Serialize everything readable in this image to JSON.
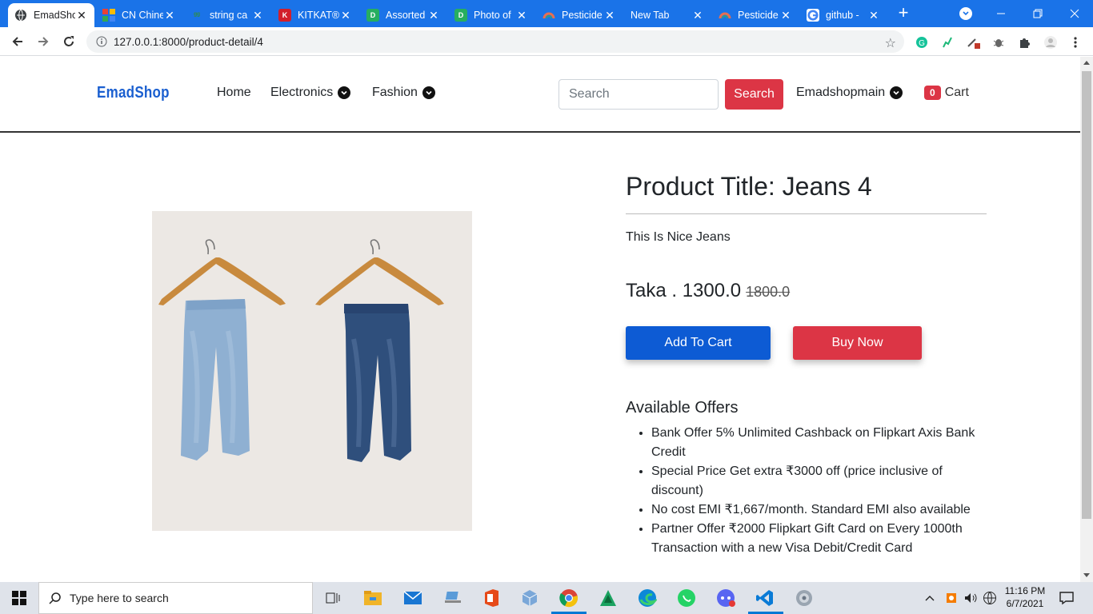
{
  "browser": {
    "tabs": [
      {
        "title": "EmadShop",
        "active": true,
        "favicon": "globe-icon",
        "color": "#3c4043"
      },
      {
        "title": "CN Chinese",
        "favicon": "grid-icon",
        "color": "#e94235"
      },
      {
        "title": "string ca",
        "favicon": "gfg-icon",
        "color": "#2f8d46"
      },
      {
        "title": "KITKAT®",
        "favicon": "kitkat-icon",
        "color": "#d21f2b"
      },
      {
        "title": "Assorted",
        "favicon": "d-icon",
        "color": "#27ae60"
      },
      {
        "title": "Photo of",
        "favicon": "d-icon",
        "color": "#27ae60"
      },
      {
        "title": "Pesticide",
        "favicon": "pesticide-icon",
        "color": "#f4a261"
      },
      {
        "title": "New Tab",
        "favicon": "",
        "color": ""
      },
      {
        "title": "Pesticide",
        "favicon": "pesticide-icon",
        "color": "#f4a261"
      },
      {
        "title": "github -",
        "favicon": "google-icon",
        "color": "#4285f4"
      }
    ],
    "url": "127.0.0.1:8000/product-detail/4"
  },
  "site": {
    "brand": "EmadShop",
    "nav": {
      "home": "Home",
      "electronics": "Electronics",
      "fashion": "Fashion"
    },
    "search": {
      "placeholder": "Search",
      "button": "Search"
    },
    "user": "Emadshopmain",
    "cart": {
      "count": "0",
      "label": "Cart"
    }
  },
  "product": {
    "title": "Product Title: Jeans 4",
    "description": "This Is Nice Jeans",
    "price": "Taka . 1300.0",
    "old_price": "1800.0",
    "add_to_cart": "Add To Cart",
    "buy_now": "Buy Now",
    "offers_heading": "Available Offers",
    "offers": [
      "Bank Offer 5% Unlimited Cashback on Flipkart Axis Bank Credit",
      "Special Price Get extra ₹3000 off (price inclusive of discount)",
      "No cost EMI ₹1,667/month. Standard EMI also available",
      "Partner Offer ₹2000 Flipkart Gift Card on Every 1000th Transaction with a new Visa Debit/Credit Card"
    ]
  },
  "taskbar": {
    "search_placeholder": "Type here to search",
    "time": "11:16 PM",
    "date": "6/7/2021"
  },
  "colors": {
    "tab_bar": "#1a73e8",
    "brand": "#1a5fd0",
    "danger": "#dc3545",
    "primary": "#0d5bd4"
  }
}
